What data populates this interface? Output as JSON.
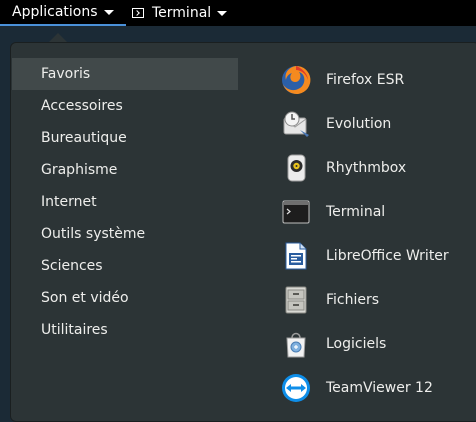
{
  "topbar": {
    "applications_label": "Applications",
    "terminal_label": "Terminal"
  },
  "menu": {
    "categories": [
      {
        "label": "Favoris",
        "selected": true
      },
      {
        "label": "Accessoires"
      },
      {
        "label": "Bureautique"
      },
      {
        "label": "Graphisme"
      },
      {
        "label": "Internet"
      },
      {
        "label": "Outils système"
      },
      {
        "label": "Sciences"
      },
      {
        "label": "Son et vidéo"
      },
      {
        "label": "Utilitaires"
      }
    ],
    "apps": [
      {
        "label": "Firefox ESR",
        "icon": "firefox-icon"
      },
      {
        "label": "Evolution",
        "icon": "evolution-icon"
      },
      {
        "label": "Rhythmbox",
        "icon": "rhythmbox-icon"
      },
      {
        "label": "Terminal",
        "icon": "terminal-icon"
      },
      {
        "label": "LibreOffice Writer",
        "icon": "libreoffice-writer-icon"
      },
      {
        "label": "Fichiers",
        "icon": "files-icon"
      },
      {
        "label": "Logiciels",
        "icon": "software-icon"
      },
      {
        "label": "TeamViewer 12",
        "icon": "teamviewer-icon"
      }
    ]
  },
  "colors": {
    "topbar_bg": "#000000",
    "accent_underline": "#4a90d9",
    "popup_bg": "#2c3436",
    "selected_bg": "#41494a",
    "text": "#eeeeec"
  }
}
